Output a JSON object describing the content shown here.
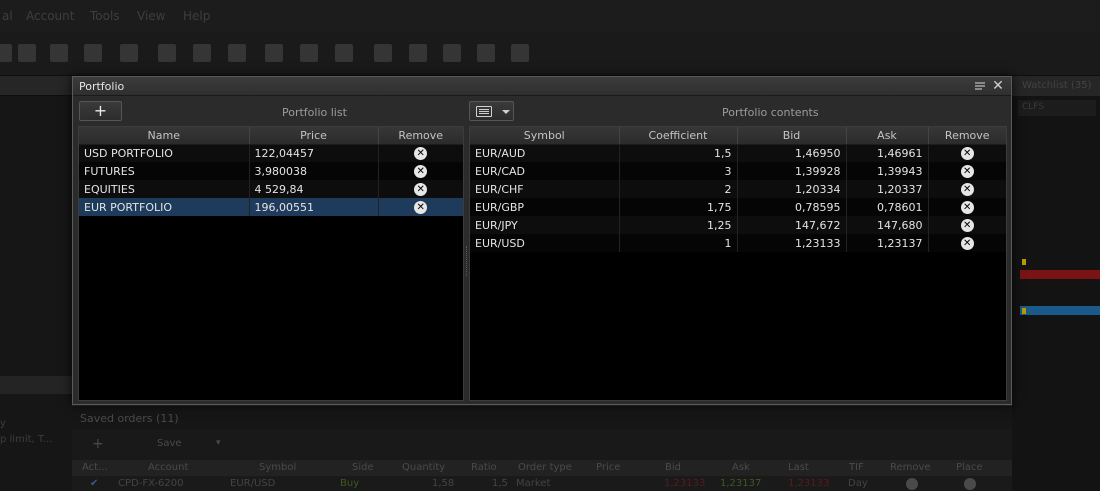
{
  "app": {
    "menu": [
      "al",
      "Account",
      "Tools",
      "View",
      "Help"
    ]
  },
  "background": {
    "left_text": [
      "y",
      "p limit, T..."
    ],
    "watchlist_title": "Watchlist (35)",
    "watchlist_sub": "CLFS",
    "saved_orders": {
      "title": "Saved orders (11)",
      "save_label": "Save",
      "columns": [
        "Act...",
        "Account",
        "Symbol",
        "Side",
        "Quantity",
        "Ratio",
        "Order type",
        "Price",
        "Bid",
        "Ask",
        "Last",
        "TIF",
        "Remove",
        "Place"
      ],
      "row": [
        "✔",
        "CPD-FX-6200",
        "EUR/USD",
        "Buy",
        "1,58",
        "1,5",
        "Market",
        "",
        "1,23133",
        "1,23137",
        "1,23133",
        "Day",
        "",
        ""
      ]
    }
  },
  "window": {
    "title": "Portfolio",
    "close_glyph": "✕",
    "add_glyph": "+",
    "portfolio_list_label": "Portfolio list",
    "portfolio_contents_label": "Portfolio contents",
    "remove_glyph": "✕"
  },
  "portfolio_list": {
    "columns": [
      "Name",
      "Price",
      "Remove"
    ],
    "rows": [
      {
        "name": "USD PORTFOLIO",
        "price": "122,04457"
      },
      {
        "name": "FUTURES",
        "price": "3,980038"
      },
      {
        "name": "EQUITIES",
        "price": "4 529,84"
      },
      {
        "name": "EUR PORTFOLIO",
        "price": "196,00551"
      }
    ]
  },
  "portfolio_contents": {
    "columns": [
      "Symbol",
      "Coefficient",
      "Bid",
      "Ask",
      "Remove"
    ],
    "rows": [
      {
        "symbol": "EUR/AUD",
        "coefficient": "1,5",
        "bid": "1,46950",
        "ask": "1,46961"
      },
      {
        "symbol": "EUR/CAD",
        "coefficient": "3",
        "bid": "1,39928",
        "ask": "1,39943"
      },
      {
        "symbol": "EUR/CHF",
        "coefficient": "2",
        "bid": "1,20334",
        "ask": "1,20337"
      },
      {
        "symbol": "EUR/GBP",
        "coefficient": "1,75",
        "bid": "0,78595",
        "ask": "0,78601"
      },
      {
        "symbol": "EUR/JPY",
        "coefficient": "1,25",
        "bid": "147,672",
        "ask": "147,680"
      },
      {
        "symbol": "EUR/USD",
        "coefficient": "1",
        "bid": "1,23133",
        "ask": "1,23137"
      }
    ]
  },
  "colors": {
    "selected_row": "#1f3b5c",
    "bg_red_bar": "#7a1414",
    "bg_blue_bar": "#1a5a8a",
    "bg_marker": "#b59b00"
  }
}
